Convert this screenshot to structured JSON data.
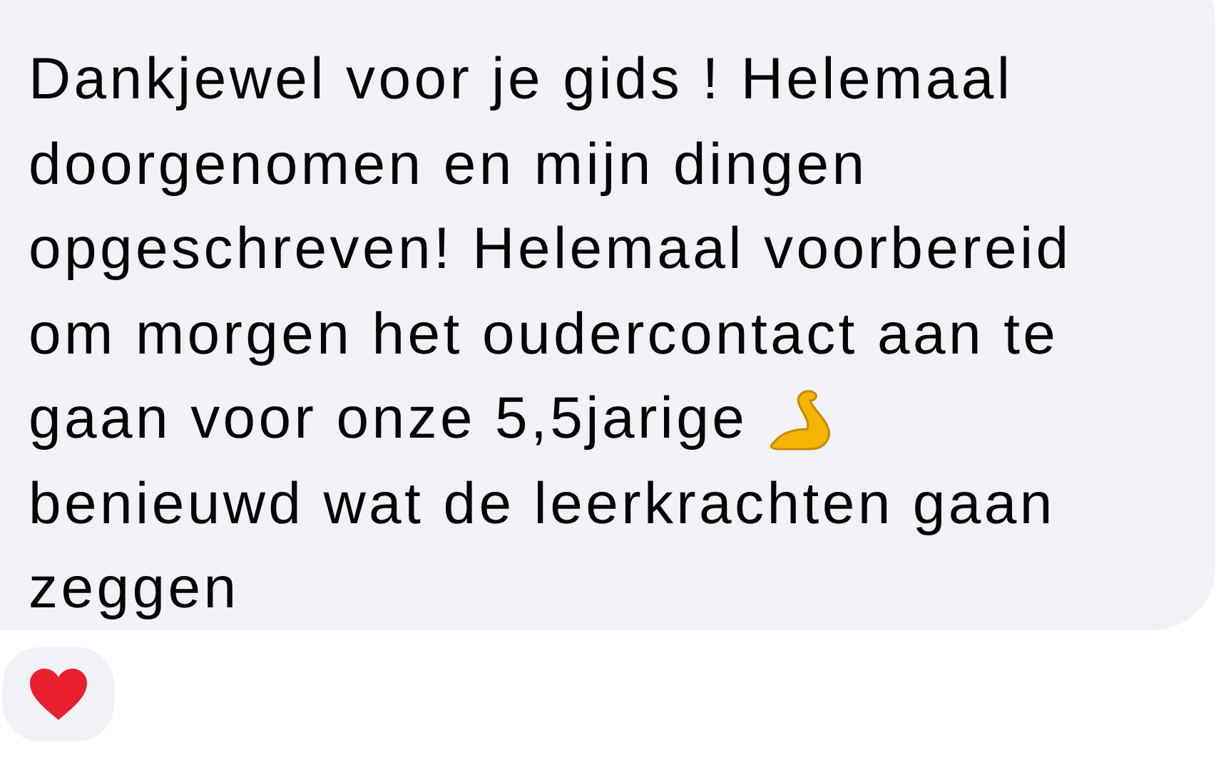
{
  "message": {
    "lines": [
      {
        "text": "Dankjewel voor je gids ! Helemaal",
        "emoji": false
      },
      {
        "text": "doorgenomen en mijn dingen",
        "emoji": false
      },
      {
        "text": "opgeschreven! Helemaal voorbereid",
        "emoji": false
      },
      {
        "text": "om morgen het oudercontact aan te",
        "emoji": false
      },
      {
        "text": "gaan voor onze 5,5jarige",
        "emoji": true
      },
      {
        "text": "benieuwd wat de leerkrachten gaan",
        "emoji": false
      },
      {
        "text": "zeggen",
        "emoji": false
      }
    ]
  }
}
